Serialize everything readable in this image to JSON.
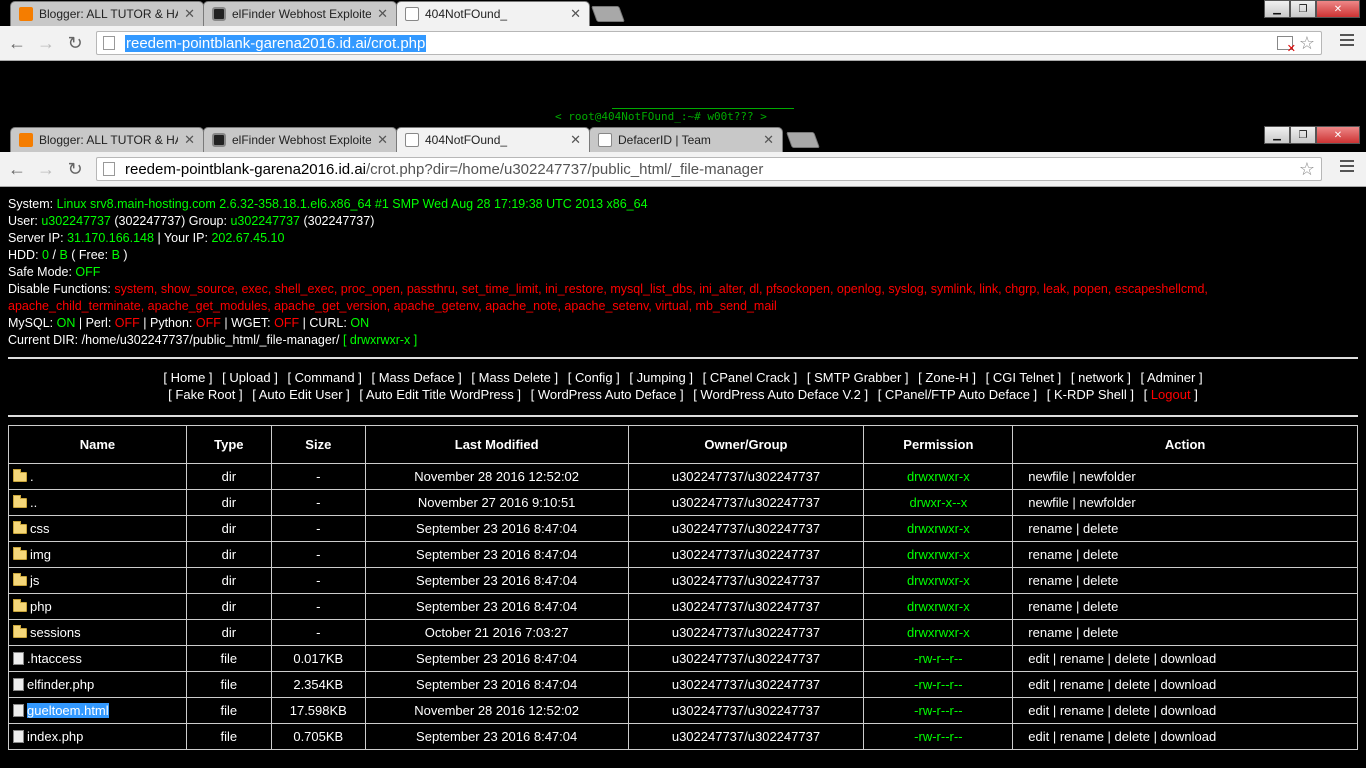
{
  "window1": {
    "tabs": [
      {
        "title": "Blogger: ALL TUTOR & HA",
        "icon": "blogger-icon"
      },
      {
        "title": "elFinder Webhost Exploite",
        "icon": "codepen-icon"
      },
      {
        "title": "404NotFOund_",
        "icon": "page-icon"
      }
    ],
    "url": "reedem-pointblank-garena2016.id.ai/crot.php"
  },
  "prompt": "< root@404NotFOund_:~# w00t??? >",
  "window2": {
    "tabs": [
      {
        "title": "Blogger: ALL TUTOR & HA",
        "icon": "blogger-icon"
      },
      {
        "title": "elFinder Webhost Exploite",
        "icon": "codepen-icon"
      },
      {
        "title": "404NotFOund_",
        "icon": "page-icon"
      },
      {
        "title": "DefacerID | Team",
        "icon": "page-icon"
      }
    ],
    "url_host": "reedem-pointblank-garena2016.id.ai",
    "url_path": "/crot.php?dir=/home/u302247737/public_html/_file-manager"
  },
  "info": {
    "system_label": "System:",
    "system_value": "Linux srv8.main-hosting.com 2.6.32-358.18.1.el6.x86_64 #1 SMP Wed Aug 28 17:19:38 UTC 2013 x86_64",
    "user_label": "User:",
    "user_value": "u302247737",
    "user_id": "(302247737)",
    "group_label": "Group:",
    "group_value": "u302247737",
    "group_id": "(302247737)",
    "serverip_label": "Server IP:",
    "serverip_value": "31.170.166.148",
    "yourip_label": "| Your IP:",
    "yourip_value": "202.67.45.10",
    "hdd_label": "HDD:",
    "hdd_total": "0",
    "hdd_sep": "/",
    "hdd_free": "B",
    "hdd_free_label": "( Free:",
    "hdd_free_value": "B",
    "hdd_close": ")",
    "safemode_label": "Safe Mode:",
    "safemode_value": "OFF",
    "disable_label": "Disable Functions:",
    "disable_line1": "system, show_source, exec, shell_exec, proc_open, passthru, set_time_limit, ini_restore, mysql_list_dbs, ini_alter, dl, pfsockopen, openlog, syslog, symlink, link, chgrp, leak, popen, escapeshellcmd,",
    "disable_line2": "apache_child_terminate, apache_get_modules, apache_get_version, apache_getenv, apache_note, apache_setenv, virtual, mb_send_mail",
    "mysql_label": "MySQL:",
    "mysql_value": "ON",
    "perl_label": "| Perl:",
    "perl_value": "OFF",
    "python_label": "| Python:",
    "python_value": "OFF",
    "wget_label": "| WGET:",
    "wget_value": "OFF",
    "curl_label": "| CURL:",
    "curl_value": "ON",
    "curdir_label": "Current DIR:",
    "curdir_value": "/home/u302247737/public_html/_file-manager/",
    "curdir_perm": "[ drwxrwxr-x ]"
  },
  "menu_row1": [
    "[ Home ]",
    "[ Upload ]",
    "[ Command ]",
    "[ Mass Deface ]",
    "[ Mass Delete ]",
    "[ Config ]",
    "[ Jumping ]",
    "[ CPanel Crack ]",
    "[ SMTP Grabber ]",
    "[ Zone-H ]",
    "[ CGI Telnet ]",
    "[ network ]",
    "[ Adminer ]"
  ],
  "menu_row2": [
    "[ Fake Root ]",
    "[ Auto Edit User ]",
    "[ Auto Edit Title WordPress ]",
    "[ WordPress Auto Deface ]",
    "[ WordPress Auto Deface V.2 ]",
    "[ CPanel/FTP Auto Deface ]",
    "[ K-RDP Shell ]"
  ],
  "logout": {
    "pre": "[ ",
    "label": "Logout",
    "post": " ]"
  },
  "table": {
    "headers": [
      "Name",
      "Type",
      "Size",
      "Last Modified",
      "Owner/Group",
      "Permission",
      "Action"
    ],
    "rows": [
      {
        "name": ".",
        "type": "dir",
        "size": "-",
        "modified": "November 28 2016 12:52:02",
        "owner": "u302247737/u302247737",
        "perm": "drwxrwxr-x",
        "actions": "newfile | newfolder",
        "kind": "folder"
      },
      {
        "name": "..",
        "type": "dir",
        "size": "-",
        "modified": "November 27 2016 9:10:51",
        "owner": "u302247737/u302247737",
        "perm": "drwxr-x--x",
        "actions": "newfile | newfolder",
        "kind": "folder"
      },
      {
        "name": "css",
        "type": "dir",
        "size": "-",
        "modified": "September 23 2016 8:47:04",
        "owner": "u302247737/u302247737",
        "perm": "drwxrwxr-x",
        "actions": "rename | delete",
        "kind": "folder"
      },
      {
        "name": "img",
        "type": "dir",
        "size": "-",
        "modified": "September 23 2016 8:47:04",
        "owner": "u302247737/u302247737",
        "perm": "drwxrwxr-x",
        "actions": "rename | delete",
        "kind": "folder"
      },
      {
        "name": "js",
        "type": "dir",
        "size": "-",
        "modified": "September 23 2016 8:47:04",
        "owner": "u302247737/u302247737",
        "perm": "drwxrwxr-x",
        "actions": "rename | delete",
        "kind": "folder"
      },
      {
        "name": "php",
        "type": "dir",
        "size": "-",
        "modified": "September 23 2016 8:47:04",
        "owner": "u302247737/u302247737",
        "perm": "drwxrwxr-x",
        "actions": "rename | delete",
        "kind": "folder"
      },
      {
        "name": "sessions",
        "type": "dir",
        "size": "-",
        "modified": "October 21 2016 7:03:27",
        "owner": "u302247737/u302247737",
        "perm": "drwxrwxr-x",
        "actions": "rename | delete",
        "kind": "folder"
      },
      {
        "name": ".htaccess",
        "type": "file",
        "size": "0.017KB",
        "modified": "September 23 2016 8:47:04",
        "owner": "u302247737/u302247737",
        "perm": "-rw-r--r--",
        "actions": "edit | rename | delete | download",
        "kind": "file"
      },
      {
        "name": "elfinder.php",
        "type": "file",
        "size": "2.354KB",
        "modified": "September 23 2016 8:47:04",
        "owner": "u302247737/u302247737",
        "perm": "-rw-r--r--",
        "actions": "edit | rename | delete | download",
        "kind": "file"
      },
      {
        "name": "gueltoem.html",
        "type": "file",
        "size": "17.598KB",
        "modified": "November 28 2016 12:52:02",
        "owner": "u302247737/u302247737",
        "perm": "-rw-r--r--",
        "actions": "edit | rename | delete | download",
        "kind": "file",
        "selected": true
      },
      {
        "name": "index.php",
        "type": "file",
        "size": "0.705KB",
        "modified": "September 23 2016 8:47:04",
        "owner": "u302247737/u302247737",
        "perm": "-rw-r--r--",
        "actions": "edit | rename | delete | download",
        "kind": "file"
      }
    ]
  }
}
